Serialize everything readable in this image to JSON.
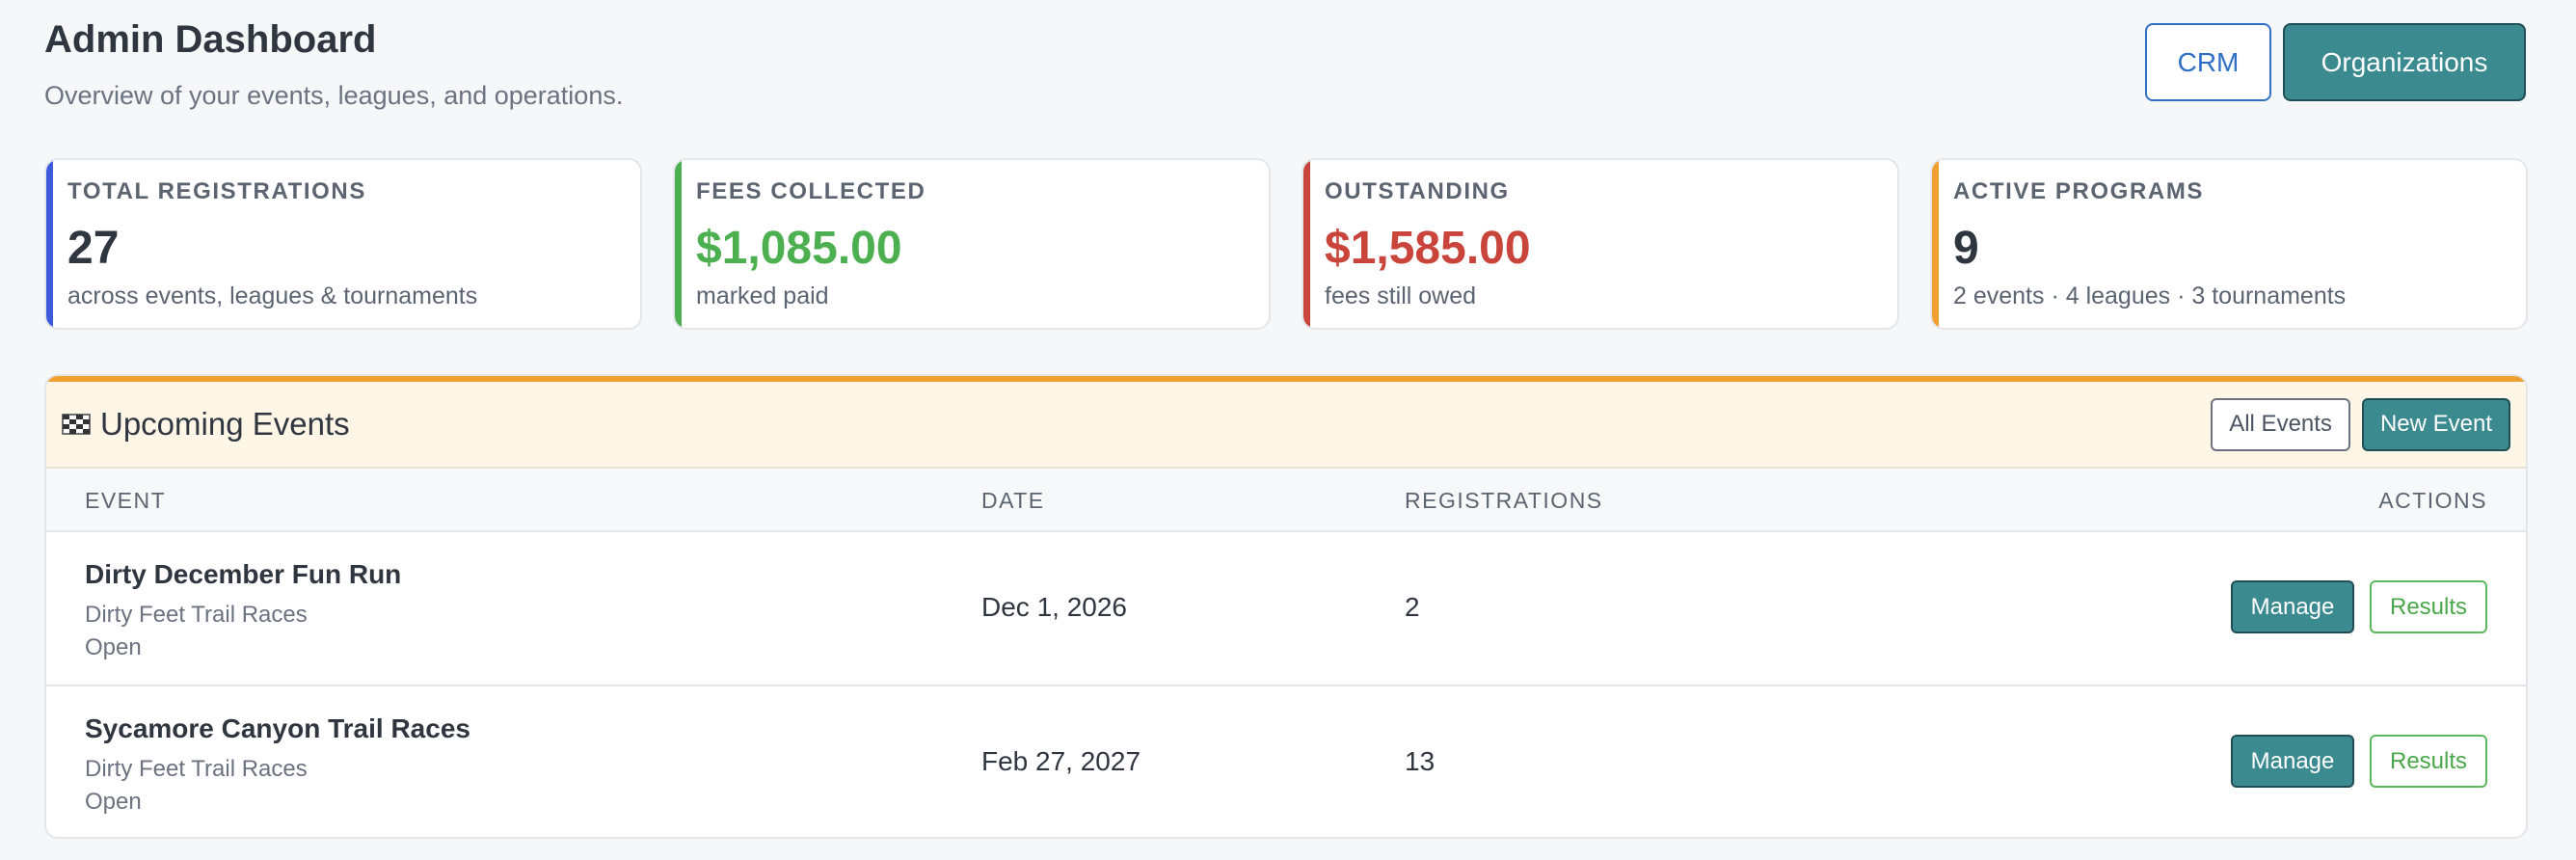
{
  "header": {
    "title": "Admin Dashboard",
    "subtitle": "Overview of your events, leagues, and operations.",
    "crm_label": "CRM",
    "orgs_label": "Organizations"
  },
  "stats": [
    {
      "label": "TOTAL REGISTRATIONS",
      "value": "27",
      "caption": "across events, leagues & tournaments",
      "accent": "#3b5bdb",
      "value_color": "#2f3640"
    },
    {
      "label": "FEES COLLECTED",
      "value": "$1,085.00",
      "caption": "marked paid",
      "accent": "#4caf50",
      "value_color": "#4caf50"
    },
    {
      "label": "OUTSTANDING",
      "value": "$1,585.00",
      "caption": "fees still owed",
      "accent": "#c9453b",
      "value_color": "#c9453b"
    },
    {
      "label": "ACTIVE PROGRAMS",
      "value": "9",
      "caption": "2 events · 4 leagues · 3 tournaments",
      "accent": "#f0a030",
      "value_color": "#2f3640"
    }
  ],
  "events": {
    "title": "Upcoming Events",
    "icon": "checkered-flag-icon",
    "accent": "#f0a030",
    "all_label": "All Events",
    "new_label": "New Event",
    "columns": {
      "event": "EVENT",
      "date": "DATE",
      "registrations": "REGISTRATIONS",
      "actions": "ACTIONS"
    },
    "rows": [
      {
        "name": "Dirty December Fun Run",
        "org": "Dirty Feet Trail Races",
        "status": "Open",
        "date": "Dec 1, 2026",
        "registrations": "2",
        "manage_label": "Manage",
        "results_label": "Results"
      },
      {
        "name": "Sycamore Canyon Trail Races",
        "org": "Dirty Feet Trail Races",
        "status": "Open",
        "date": "Feb 27, 2027",
        "registrations": "13",
        "manage_label": "Manage",
        "results_label": "Results"
      }
    ]
  }
}
